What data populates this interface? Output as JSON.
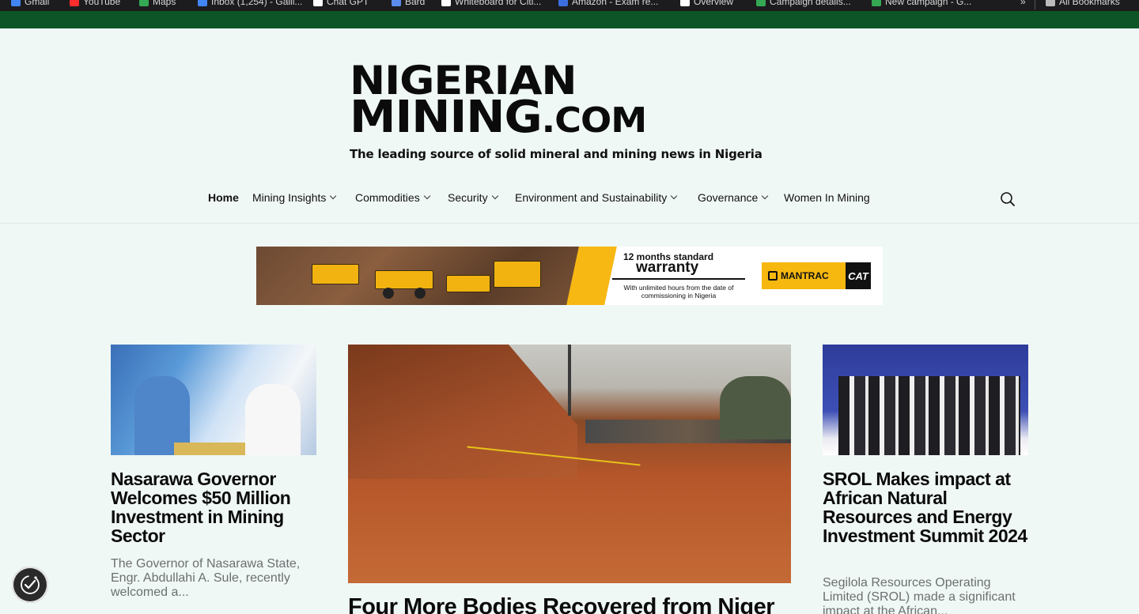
{
  "browser": {
    "bookmarks": [
      {
        "label": "Gmail",
        "color": "#4285f4"
      },
      {
        "label": "YouTube",
        "color": "#ff2d2d"
      },
      {
        "label": "Maps",
        "color": "#34a853"
      },
      {
        "label": "Inbox (1,254) - Galli...",
        "color": "#4285f4"
      },
      {
        "label": "Chat GPT",
        "color": "#ffffff"
      },
      {
        "label": "Bard",
        "color": "#5b8def"
      },
      {
        "label": "Whiteboard for Citi...",
        "color": "#ffffff"
      },
      {
        "label": "Amazon - Exam re...",
        "color": "#3b6fe0"
      },
      {
        "label": "Overview",
        "color": "#ffffff"
      },
      {
        "label": "Campaign details...",
        "color": "#34a853"
      },
      {
        "label": "New campaign - G...",
        "color": "#34a853"
      }
    ],
    "overflow": "»",
    "all_bookmarks": "All Bookmarks"
  },
  "site": {
    "logo_line1": "NIGERIAN",
    "logo_line2": "MINING",
    "logo_tld": ".COM",
    "tagline": "The leading source of solid mineral and mining news in Nigeria",
    "brand_color": "#0d5526"
  },
  "nav": {
    "items": [
      {
        "label": "Home",
        "active": true,
        "dropdown": false
      },
      {
        "label": "Mining Insights",
        "active": false,
        "dropdown": true
      },
      {
        "label": "Commodities",
        "active": false,
        "dropdown": true
      },
      {
        "label": "Security",
        "active": false,
        "dropdown": true
      },
      {
        "label": "Environment and Sustainability",
        "active": false,
        "dropdown": true
      },
      {
        "label": "Governance",
        "active": false,
        "dropdown": true
      },
      {
        "label": "Women In Mining",
        "active": false,
        "dropdown": false
      }
    ],
    "search_icon": "search-icon"
  },
  "banner": {
    "small": "12 months standard",
    "big": "warranty",
    "sub": "With unlimited hours from the date of commissioning in Nigeria",
    "brand1": "MANTRAC",
    "brand2": "CAT"
  },
  "articles": {
    "left": {
      "headline": "Nasarawa Governor Welcomes $50 Million Investment in Mining Sector",
      "excerpt": "The Governor of Nasarawa State, Engr. Abdullahi A. Sule, recently welcomed a..."
    },
    "center": {
      "headline": "Four More Bodies Recovered from Niger"
    },
    "right": {
      "headline": "SROL Makes impact at African Natural Resources and Energy Investment Summit 2024",
      "excerpt": "Segilola Resources Operating Limited (SROL) made a significant impact at the African..."
    }
  },
  "accessibility": {
    "icon": "accessibility-icon"
  }
}
